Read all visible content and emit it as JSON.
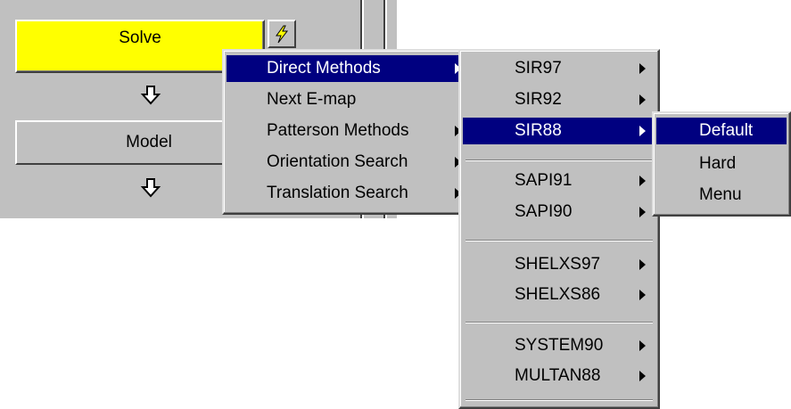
{
  "toolbar": {
    "solve_label": "Solve",
    "model_label": "Model"
  },
  "direct_menu": {
    "items": [
      {
        "label": "Direct Methods",
        "submenu": true,
        "highlighted": true
      },
      {
        "label": "Next E-map",
        "submenu": false,
        "highlighted": false
      },
      {
        "label": "Patterson Methods",
        "submenu": true,
        "highlighted": false
      },
      {
        "label": "Orientation Search",
        "submenu": true,
        "highlighted": false
      },
      {
        "label": "Translation Search",
        "submenu": true,
        "highlighted": false
      }
    ]
  },
  "methods_menu": {
    "items": [
      {
        "label": "SIR97",
        "submenu": true,
        "highlighted": false
      },
      {
        "label": "SIR92",
        "submenu": true,
        "highlighted": false
      },
      {
        "label": "SIR88",
        "submenu": true,
        "highlighted": true
      },
      {
        "label": "SAPI91",
        "submenu": true,
        "highlighted": false
      },
      {
        "label": "SAPI90",
        "submenu": true,
        "highlighted": false
      },
      {
        "label": "SHELXS97",
        "submenu": true,
        "highlighted": false
      },
      {
        "label": "SHELXS86",
        "submenu": true,
        "highlighted": false
      },
      {
        "label": "SYSTEM90",
        "submenu": true,
        "highlighted": false
      },
      {
        "label": "MULTAN88",
        "submenu": true,
        "highlighted": false
      }
    ]
  },
  "sir88_menu": {
    "items": [
      {
        "label": "Default",
        "highlighted": true
      },
      {
        "label": "Hard",
        "highlighted": false
      },
      {
        "label": "Menu",
        "highlighted": false
      }
    ]
  },
  "colors": {
    "panel": "#c0c0c0",
    "solve_button": "#ffff00",
    "highlight": "#000080",
    "highlight_text": "#ffffff"
  }
}
